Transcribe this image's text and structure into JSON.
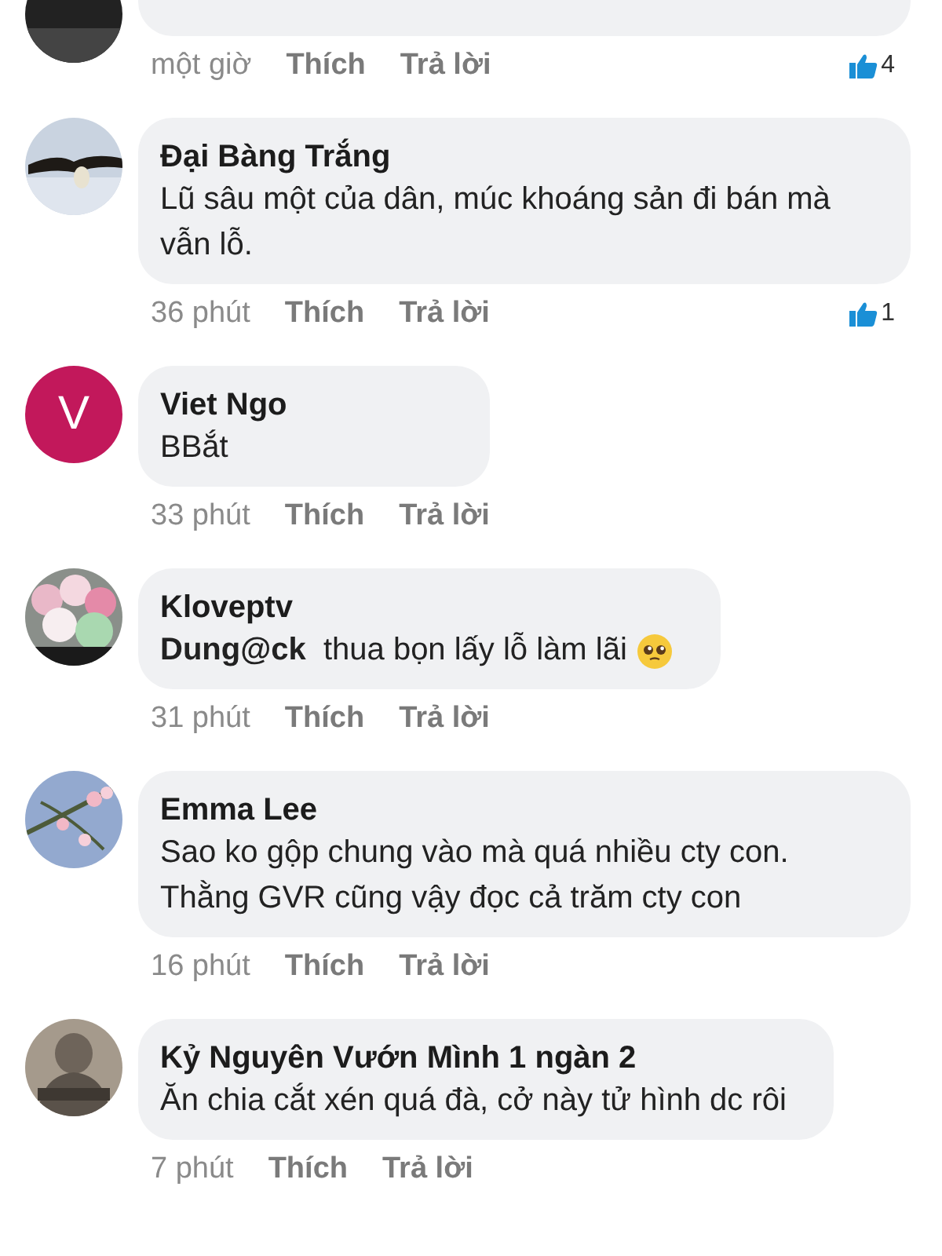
{
  "comments": [
    {
      "time": "một giờ",
      "like_label": "Thích",
      "reply_label": "Trả lời",
      "likes": "4"
    },
    {
      "author": "Đại Bàng Trắng",
      "text": "Lũ sâu một của dân, múc khoáng sản đi bán mà vẫn lỗ.",
      "time": "36 phút",
      "like_label": "Thích",
      "reply_label": "Trả lời",
      "likes": "1"
    },
    {
      "author": "Viet Ngo",
      "avatar": {
        "kind": "letter",
        "letter": "V",
        "color": "#c2185b"
      },
      "text": "BBắt",
      "time": "33 phút",
      "like_label": "Thích",
      "reply_label": "Trả lời"
    },
    {
      "author": "Kloveptv",
      "text": "**Dung@ck**  thua bọn lấy lỗ làm lãi",
      "emoji": true,
      "time": "31 phút",
      "like_label": "Thích",
      "reply_label": "Trả lời"
    },
    {
      "author": "Emma Lee",
      "text": "Sao ko gộp chung vào mà quá nhiều cty con. Thằng GVR cũng vậy đọc cả trăm cty con",
      "time": "16 phút",
      "like_label": "Thích",
      "reply_label": "Trả lời"
    },
    {
      "author": "Kỷ Nguyên Vướn Mình 1 ngàn 2",
      "text": "Ăn chia cắt xén quá đà, cở này tử hình dc rôi",
      "time": "7 phút",
      "like_label": "Thích",
      "reply_label": "Trả lời"
    }
  ]
}
